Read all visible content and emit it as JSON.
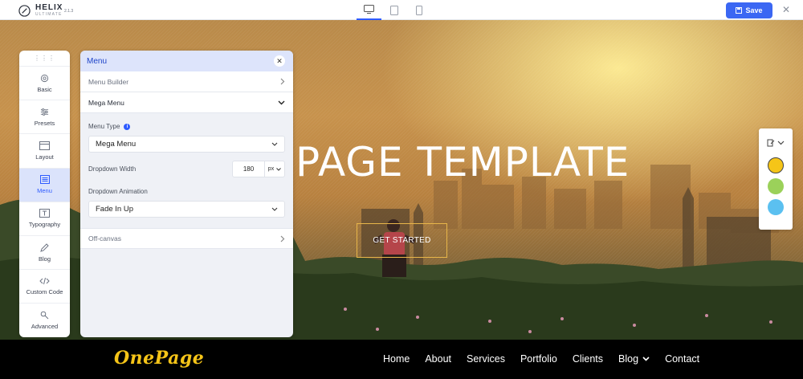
{
  "topbar": {
    "logo_name": "HELIX",
    "logo_sub": "ULTIMATE",
    "version": "2.1.3",
    "save_label": "Save"
  },
  "hero": {
    "title": "PAGE TEMPLATE",
    "cta": "GET STARTED"
  },
  "sidebar": {
    "items": [
      {
        "label": "Basic",
        "icon": "gear-icon"
      },
      {
        "label": "Presets",
        "icon": "sliders-icon"
      },
      {
        "label": "Layout",
        "icon": "layout-icon"
      },
      {
        "label": "Menu",
        "icon": "menu-icon"
      },
      {
        "label": "Typography",
        "icon": "typography-icon"
      },
      {
        "label": "Blog",
        "icon": "blog-icon"
      },
      {
        "label": "Custom Code",
        "icon": "code-icon"
      },
      {
        "label": "Advanced",
        "icon": "advanced-icon"
      }
    ],
    "active": "Menu"
  },
  "panel": {
    "title": "Menu",
    "menu_builder": "Menu Builder",
    "mega_menu": "Mega Menu",
    "menu_type_label": "Menu Type",
    "menu_type_value": "Mega Menu",
    "dropdown_width_label": "Dropdown Width",
    "dropdown_width_value": "180",
    "dropdown_width_unit": "px",
    "dropdown_animation_label": "Dropdown Animation",
    "dropdown_animation_value": "Fade In Up",
    "off_canvas": "Off-canvas"
  },
  "color_panel": {
    "swatches": [
      "#f5c518",
      "#9bd15a",
      "#5bc0f0"
    ]
  },
  "footer": {
    "brand_1": "One",
    "brand_2": "Page",
    "nav": [
      "Home",
      "About",
      "Services",
      "Portfolio",
      "Clients",
      "Blog",
      "Contact"
    ]
  },
  "colors": {
    "accent": "#3b67f3",
    "panel_head": "#dde4fb",
    "brand_yellow": "#f5c418"
  }
}
